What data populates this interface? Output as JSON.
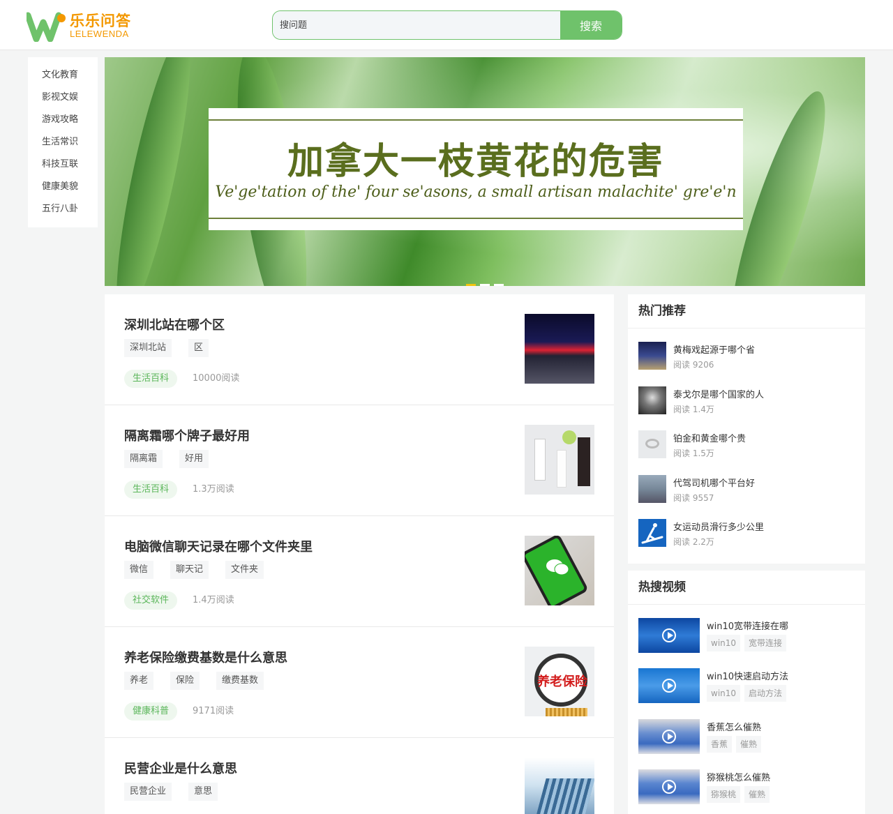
{
  "header": {
    "logo_cn": "乐乐问答",
    "logo_en": "LELEWENDA",
    "search_placeholder": "搜问题",
    "search_button": "搜索"
  },
  "categories": [
    "文化教育",
    "影视文娱",
    "游戏攻略",
    "生活常识",
    "科技互联",
    "健康美貌",
    "五行八卦"
  ],
  "banner": {
    "title": "加拿大一枝黄花的危害",
    "subtitle": "Ve'ge'tation of the' four se'asons, a small artisan malachite' gre'e'n"
  },
  "feed": [
    {
      "title": "深圳北站在哪个区",
      "tags": [
        "深圳北站",
        "区"
      ],
      "category": "生活百科",
      "reads": "10000阅读"
    },
    {
      "title": "隔离霜哪个牌子最好用",
      "tags": [
        "隔离霜",
        "好用"
      ],
      "category": "生活百科",
      "reads": "1.3万阅读"
    },
    {
      "title": "电脑微信聊天记录在哪个文件夹里",
      "tags": [
        "微信",
        "聊天记",
        "文件夹"
      ],
      "category": "社交软件",
      "reads": "1.4万阅读"
    },
    {
      "title": "养老保险缴费基数是什么意思",
      "tags": [
        "养老",
        "保险",
        "缴费基数"
      ],
      "category": "健康科普",
      "reads": "9171阅读",
      "thumb_text": "养老保险"
    },
    {
      "title": "民营企业是什么意思",
      "tags": [
        "民营企业",
        "意思"
      ],
      "category": "",
      "reads": ""
    }
  ],
  "hot": {
    "heading": "热门推荐",
    "items": [
      {
        "title": "黄梅戏起源于哪个省",
        "reads": "阅读 9206"
      },
      {
        "title": "泰戈尔是哪个国家的人",
        "reads": "阅读 1.4万"
      },
      {
        "title": "铂金和黄金哪个贵",
        "reads": "阅读 1.5万"
      },
      {
        "title": "代驾司机哪个平台好",
        "reads": "阅读 9557"
      },
      {
        "title": "女运动员滑行多少公里",
        "reads": "阅读 2.2万"
      }
    ]
  },
  "videos": {
    "heading": "热搜视频",
    "items": [
      {
        "title": "win10宽带连接在哪",
        "tags": [
          "win10",
          "宽带连接"
        ]
      },
      {
        "title": "win10快速启动方法",
        "tags": [
          "win10",
          "启动方法"
        ]
      },
      {
        "title": "香蕉怎么催熟",
        "tags": [
          "香蕉",
          "催熟"
        ]
      },
      {
        "title": "猕猴桃怎么催熟",
        "tags": [
          "猕猴桃",
          "催熟"
        ]
      }
    ]
  },
  "colors": {
    "accent": "#6fc26b",
    "logo": "#f39800",
    "banner_text": "#5a6e1e"
  }
}
